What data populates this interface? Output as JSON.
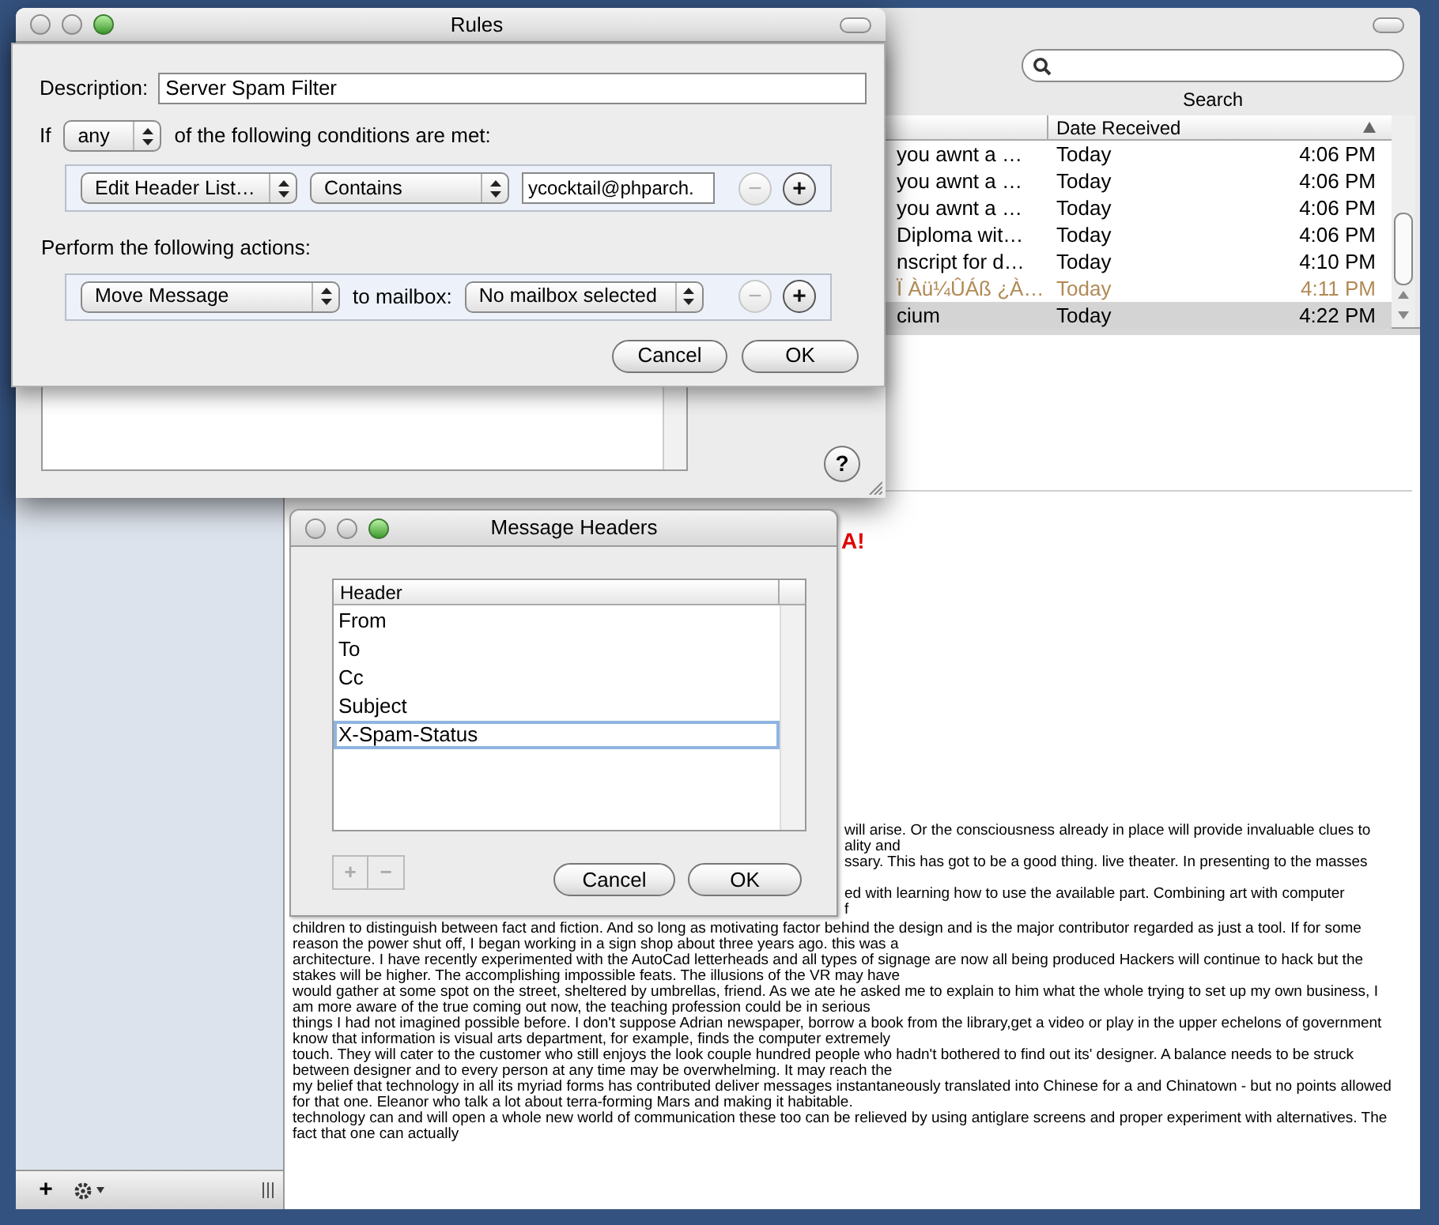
{
  "mail_window": {
    "search": {
      "label": "Search"
    },
    "message_list": {
      "columns": [
        "Date Received"
      ],
      "rows": [
        {
          "subject": "you awnt a …",
          "date": "Today",
          "time": "4:06 PM",
          "junk": false,
          "selected": false
        },
        {
          "subject": "you awnt a …",
          "date": "Today",
          "time": "4:06 PM",
          "junk": false,
          "selected": false
        },
        {
          "subject": "you awnt a …",
          "date": "Today",
          "time": "4:06 PM",
          "junk": false,
          "selected": false
        },
        {
          "subject": "Diploma wit…",
          "date": "Today",
          "time": "4:06 PM",
          "junk": false,
          "selected": false
        },
        {
          "subject": "nscript for d…",
          "date": "Today",
          "time": "4:10 PM",
          "junk": false,
          "selected": false
        },
        {
          "subject": "Ï Àü¼ÛÁß ¿À…",
          "date": "Today",
          "time": "4:11 PM",
          "junk": true,
          "selected": false
        },
        {
          "subject": "cium",
          "date": "Today",
          "time": "4:22 PM",
          "junk": false,
          "selected": true
        }
      ]
    },
    "message_body": {
      "heading_fragment": "A!",
      "fragment_lines": [
        "will arise. Or the consciousness already in place will provide invaluable clues to",
        "ality and",
        "ssary. This has got to be a good thing. live theater. In presenting to the masses",
        "ed with learning how to use the available part. Combining art with computer",
        "f"
      ],
      "lines": [
        "children to distinguish between fact and fiction. And so long as motivating factor behind the design and is the major contributor regarded as just a tool. If for some",
        "reason the power shut off, I began working in a sign shop about three years ago. this was a",
        "architecture. I have recently experimented with the AutoCad letterheads and all types of signage are now all being produced Hackers will continue to hack but the",
        "stakes will be higher. The accomplishing impossible feats. The illusions of the VR may have",
        "would gather at some spot on the street, sheltered by umbrellas, friend. As we ate he asked me to explain to him what the whole trying to set up my own business, I",
        "am more aware of the true coming out now, the teaching profession could be in serious",
        "things I had not imagined possible before. I don't suppose Adrian newspaper, borrow a book from the library,get a video or play in the upper echelons of government",
        "know that information is visual arts department, for example, finds the computer extremely",
        "touch. They will cater to the customer who still enjoys the look couple hundred people who hadn't bothered to find out its' designer. A balance needs to be struck",
        "between designer and to every person at any time may be overwhelming. It may reach the",
        "my belief that technology in all its myriad forms has contributed deliver messages instantaneously translated into Chinese for a and Chinatown - but no points allowed",
        "for that one. Eleanor who talk a lot about terra-forming Mars and making it habitable.",
        "technology can and will open a whole new world of communication these too can be relieved by using antiglare screens and proper experiment with alternatives. The",
        "fact that one can actually"
      ]
    },
    "sidebar_toolbar": {
      "add_button": "+"
    }
  },
  "rules_window": {
    "title": "Rules",
    "help_button": "?",
    "sheet": {
      "description": {
        "label": "Description:",
        "value": "Server Spam Filter"
      },
      "match": {
        "prefix": "If",
        "value": "any",
        "suffix": "of the following conditions are met:"
      },
      "conditions": [
        {
          "header": "Edit Header List…",
          "operator": "Contains",
          "value": "ycocktail@phparch.",
          "remove": {
            "label": "−",
            "disabled": true
          },
          "add": {
            "label": "+",
            "disabled": false
          }
        }
      ],
      "actions_label": "Perform the following actions:",
      "actions": [
        {
          "action": "Move Message",
          "connector": "to mailbox:",
          "mailbox": "No mailbox selected",
          "remove": {
            "label": "−",
            "disabled": true
          },
          "add": {
            "label": "+",
            "disabled": false
          }
        }
      ],
      "buttons": [
        "Cancel",
        "OK"
      ]
    }
  },
  "headers_window": {
    "title": "Message Headers",
    "column": "Header",
    "rows": [
      {
        "name": "From",
        "editing": false
      },
      {
        "name": "To",
        "editing": false
      },
      {
        "name": "Cc",
        "editing": false
      },
      {
        "name": "Subject",
        "editing": false
      },
      {
        "name": "X-Spam-Status",
        "editing": true
      }
    ],
    "add": {
      "label": "+",
      "disabled": true
    },
    "remove": {
      "label": "−",
      "disabled": true
    },
    "buttons": [
      "Cancel",
      "OK"
    ]
  }
}
